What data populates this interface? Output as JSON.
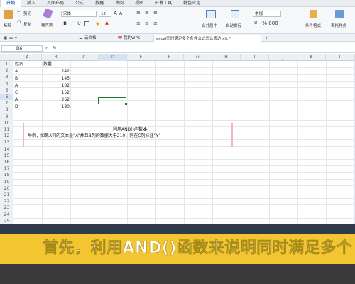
{
  "ribbon": {
    "tabs": [
      "开始",
      "插入",
      "页面布局",
      "公式",
      "数据",
      "审阅",
      "视图",
      "开发工具",
      "特色应用"
    ],
    "paste_label": "粘贴",
    "cut_label": "剪切",
    "copy_label": "复制",
    "format_painter_label": "格式刷",
    "font_name": "宋体",
    "font_size": "12",
    "bold_label": "B",
    "italic_label": "I",
    "underline_label": "U",
    "merge_label": "合并居中",
    "wrap_label": "自动换行",
    "number_format": "常规",
    "conditional_format_label": "条件格式",
    "table_style_label": "表格样式"
  },
  "doc_tabs": {
    "cloud_label": "云文档",
    "mywps_label": "我的WPS",
    "active_file": "excel同时满足多个条件公式怎么表达.xls *"
  },
  "formula_bar": {
    "cell_ref": "D6",
    "fx_label": "fx"
  },
  "grid": {
    "columns": [
      "A",
      "B",
      "C",
      "D",
      "E",
      "F",
      "G",
      "H",
      "I",
      "J",
      "K",
      "L"
    ],
    "rows": [
      "1",
      "2",
      "3",
      "4",
      "5",
      "6",
      "7",
      "8",
      "9",
      "10",
      "11",
      "12",
      "13",
      "14",
      "15",
      "16",
      "17",
      "18",
      "19",
      "20",
      "21",
      "22",
      "23",
      "24",
      "25"
    ],
    "header": {
      "name": "姓名",
      "qty": "数量"
    },
    "data": [
      {
        "name": "A",
        "qty": "242"
      },
      {
        "name": "B",
        "qty": "145"
      },
      {
        "name": "A",
        "qty": "102"
      },
      {
        "name": "C",
        "qty": "152"
      },
      {
        "name": "A",
        "qty": "262"
      },
      {
        "name": "D",
        "qty": "180"
      }
    ]
  },
  "note": {
    "title": "利用AND()函数",
    "body": "举例，如果A列的文本是“A”并且B列的数据大于210，则在C列标注“Y”"
  },
  "caption": {
    "text": "首先，利用AND()函数来说明同时满足多个"
  },
  "colors": {
    "accent": "#2b6cb0",
    "selection": "#1e7a2e",
    "caption_bg": "#f2c531"
  }
}
